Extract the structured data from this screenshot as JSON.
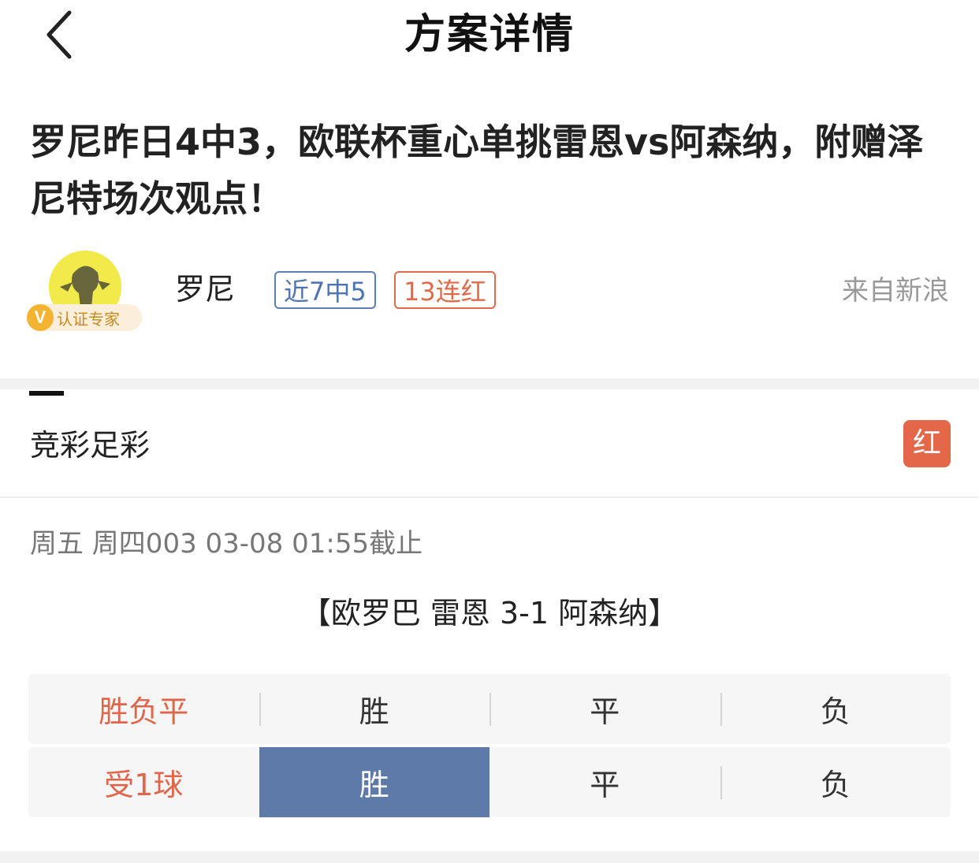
{
  "nav": {
    "title": "方案详情"
  },
  "article": {
    "title": "罗尼昨日4中3，欧联杯重心单挑雷恩vs阿森纳，附赠泽尼特场次观点！"
  },
  "author": {
    "name": "罗尼",
    "verified_label": "认证专家",
    "verified_mark": "V",
    "tags": [
      "近7中5",
      "13连红"
    ],
    "source": "来自新浪"
  },
  "plan": {
    "section_title": "竞彩足彩",
    "result_badge": "红",
    "match_info": "周五 周四003 03-08 01:55截止",
    "match_title": "【欧罗巴 雷恩 3-1 阿森纳】",
    "odds_rows": [
      {
        "label": "胜负平",
        "options": [
          "胜",
          "平",
          "负"
        ],
        "selected": null
      },
      {
        "label": "受1球",
        "options": [
          "胜",
          "平",
          "负"
        ],
        "selected": "胜"
      }
    ]
  },
  "colors": {
    "accent_red": "#e4674a",
    "tag_blue": "#4f74b2",
    "selected_blue": "#5d7aa8",
    "verify_gold": "#f4b431"
  }
}
